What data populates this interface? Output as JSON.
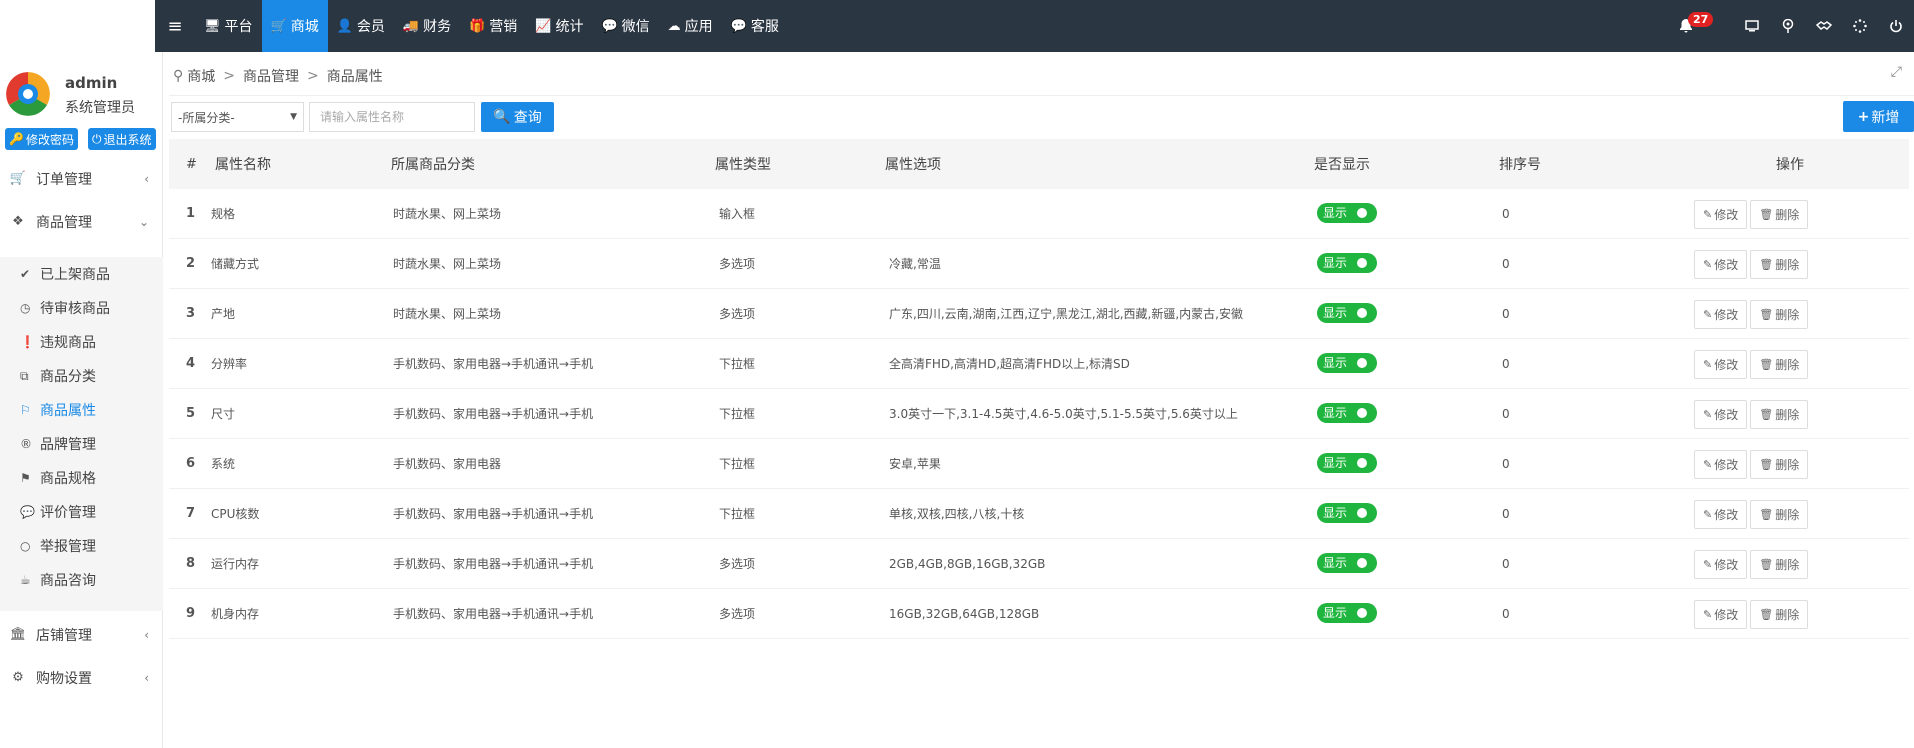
{
  "topnav": {
    "items": [
      {
        "label": "平台",
        "icon": "monitor-icon",
        "glyph": "🖥"
      },
      {
        "label": "商城",
        "icon": "cart-icon",
        "glyph": "🛒",
        "active": true
      },
      {
        "label": "会员",
        "icon": "user-icon",
        "glyph": "👤"
      },
      {
        "label": "财务",
        "icon": "truck-icon",
        "glyph": "🚚"
      },
      {
        "label": "营销",
        "icon": "gift-icon",
        "glyph": "🎁"
      },
      {
        "label": "统计",
        "icon": "chart-icon",
        "glyph": "📈"
      },
      {
        "label": "微信",
        "icon": "wechat-icon",
        "glyph": "💬"
      },
      {
        "label": "应用",
        "icon": "cloud-icon",
        "glyph": "☁"
      },
      {
        "label": "客服",
        "icon": "chat-icon",
        "glyph": "💬"
      }
    ],
    "notification_count": "27"
  },
  "sidebar": {
    "user_name": "admin",
    "user_role": "系统管理员",
    "change_password": "修改密码",
    "logout": "退出系统",
    "groups": [
      {
        "label": "订单管理"
      },
      {
        "label": "商品管理"
      },
      {
        "label": "店铺管理"
      },
      {
        "label": "购物设置"
      }
    ],
    "sub_items": [
      {
        "label": "已上架商品",
        "icon": "check-circle-icon",
        "glyph": "✔"
      },
      {
        "label": "待审核商品",
        "icon": "clock-icon",
        "glyph": "◷"
      },
      {
        "label": "违规商品",
        "icon": "warning-icon",
        "glyph": "❗"
      },
      {
        "label": "商品分类",
        "icon": "sitemap-icon",
        "glyph": "⧉"
      },
      {
        "label": "商品属性",
        "icon": "flag-icon",
        "glyph": "⚐",
        "active": true
      },
      {
        "label": "品牌管理",
        "icon": "registered-icon",
        "glyph": "®"
      },
      {
        "label": "商品规格",
        "icon": "flag-checkered-icon",
        "glyph": "⚑"
      },
      {
        "label": "评价管理",
        "icon": "comments-icon",
        "glyph": "💬"
      },
      {
        "label": "举报管理",
        "icon": "circle-icon",
        "glyph": "○"
      },
      {
        "label": "商品咨询",
        "icon": "coffee-icon",
        "glyph": "☕"
      }
    ]
  },
  "breadcrumb": [
    "商城",
    "商品管理",
    "商品属性"
  ],
  "filters": {
    "category_select": "-所属分类-",
    "search_placeholder": "请输入属性名称",
    "query_label": "查询",
    "add_label": "新增"
  },
  "table": {
    "headers": {
      "idx": "#",
      "name": "属性名称",
      "category": "所属商品分类",
      "type": "属性类型",
      "options": "属性选项",
      "show": "是否显示",
      "sort": "排序号",
      "ops": "操作"
    },
    "show_label": "显示",
    "edit_label": "修改",
    "delete_label": "删除",
    "rows": [
      {
        "idx": "1",
        "name": "规格",
        "category": "时蔬水果、网上菜场",
        "type": "输入框",
        "options": "",
        "sort": "0"
      },
      {
        "idx": "2",
        "name": "储藏方式",
        "category": "时蔬水果、网上菜场",
        "type": "多选项",
        "options": "冷藏,常温",
        "sort": "0"
      },
      {
        "idx": "3",
        "name": "产地",
        "category": "时蔬水果、网上菜场",
        "type": "多选项",
        "options": "广东,四川,云南,湖南,江西,辽宁,黑龙江,湖北,西藏,新疆,内蒙古,安徽",
        "sort": "0"
      },
      {
        "idx": "4",
        "name": "分辨率",
        "category": "手机数码、家用电器→手机通讯→手机",
        "type": "下拉框",
        "options": "全高清FHD,高清HD,超高清FHD以上,标清SD",
        "sort": "0"
      },
      {
        "idx": "5",
        "name": "尺寸",
        "category": "手机数码、家用电器→手机通讯→手机",
        "type": "下拉框",
        "options": "3.0英寸一下,3.1-4.5英寸,4.6-5.0英寸,5.1-5.5英寸,5.6英寸以上",
        "sort": "0"
      },
      {
        "idx": "6",
        "name": "系统",
        "category": "手机数码、家用电器",
        "type": "下拉框",
        "options": "安卓,苹果",
        "sort": "0"
      },
      {
        "idx": "7",
        "name": "CPU核数",
        "category": "手机数码、家用电器→手机通讯→手机",
        "type": "下拉框",
        "options": "单核,双核,四核,八核,十核",
        "sort": "0"
      },
      {
        "idx": "8",
        "name": "运行内存",
        "category": "手机数码、家用电器→手机通讯→手机",
        "type": "多选项",
        "options": "2GB,4GB,8GB,16GB,32GB",
        "sort": "0"
      },
      {
        "idx": "9",
        "name": "机身内存",
        "category": "手机数码、家用电器→手机通讯→手机",
        "type": "多选项",
        "options": "16GB,32GB,64GB,128GB",
        "sort": "0"
      }
    ]
  },
  "colors": {
    "accent": "#1a8ae6",
    "topbar": "#2b3643",
    "toggle_on": "#1fb53e",
    "badge": "#e02222"
  }
}
